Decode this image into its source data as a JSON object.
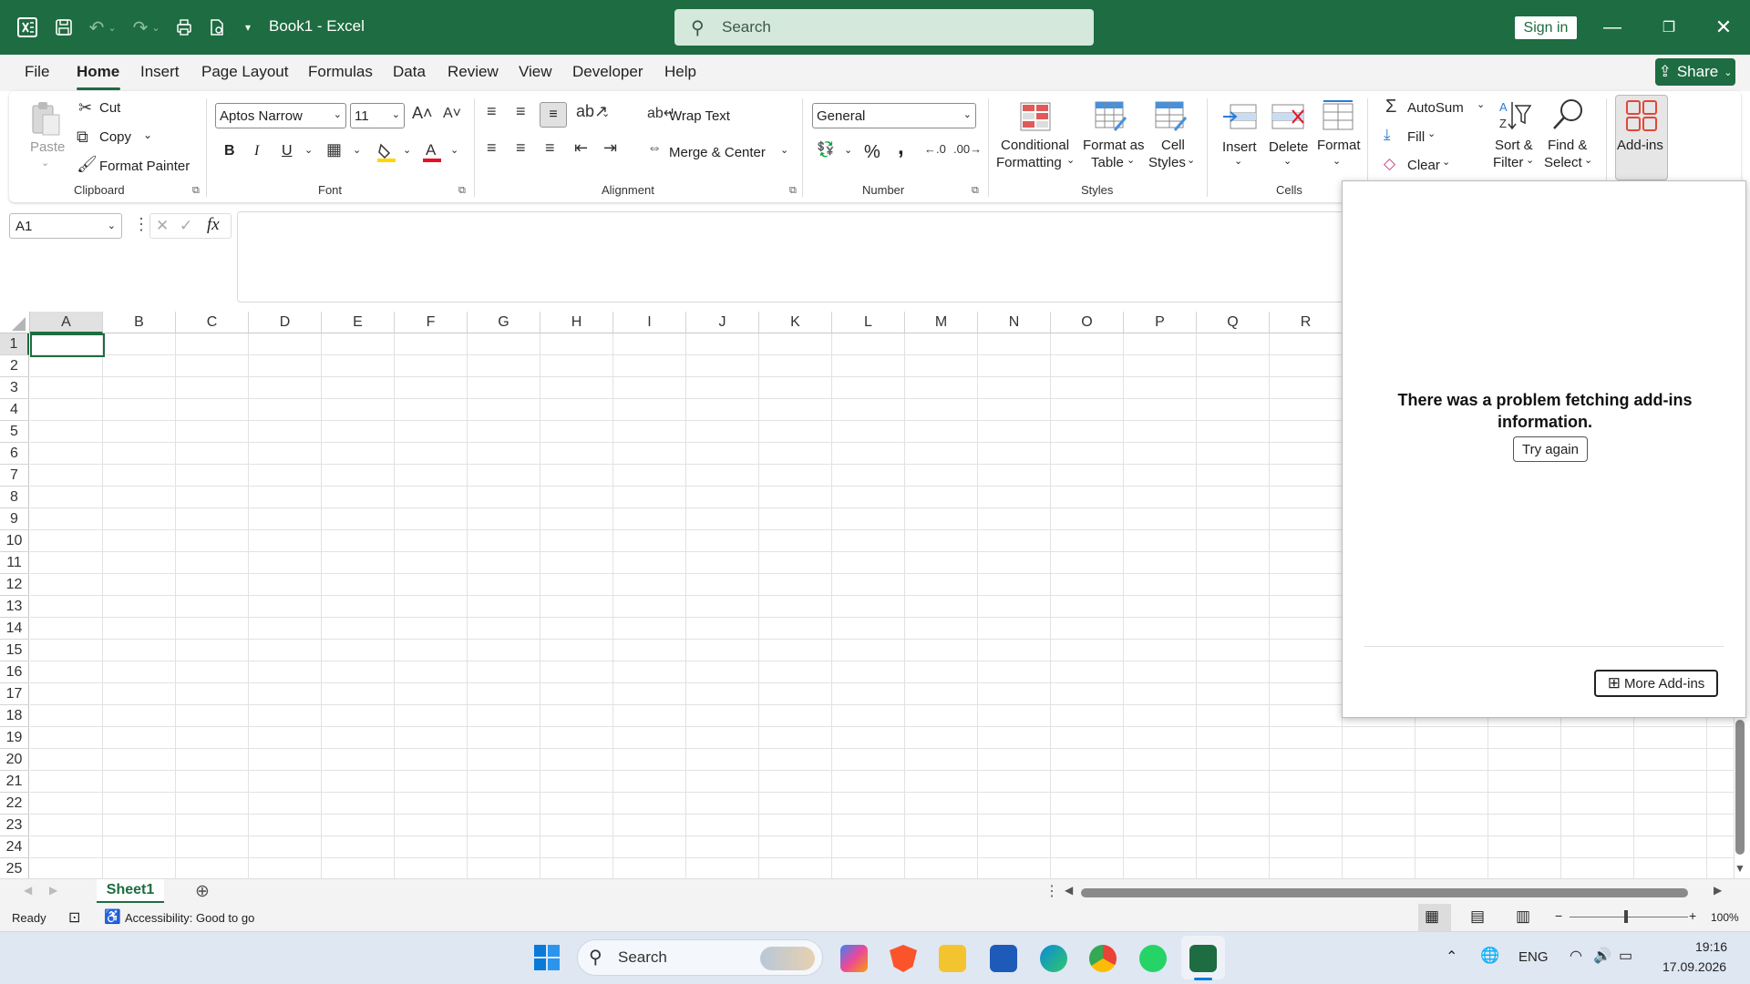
{
  "titlebar": {
    "doc_title": "Book1  -  Excel",
    "search_placeholder": "Search",
    "sign_in": "Sign in",
    "accent": "#1e6c41"
  },
  "menu": {
    "items": [
      "File",
      "Home",
      "Insert",
      "Page Layout",
      "Formulas",
      "Data",
      "Review",
      "View",
      "Developer",
      "Help"
    ],
    "active": "Home",
    "share_label": "Share"
  },
  "ribbon": {
    "clipboard": {
      "paste": "Paste",
      "cut": "Cut",
      "copy": "Copy",
      "format_painter": "Format Painter",
      "group": "Clipboard"
    },
    "font": {
      "font_name": "Aptos Narrow",
      "font_size": "11",
      "bold": "B",
      "italic": "I",
      "underline": "U",
      "group": "Font"
    },
    "alignment": {
      "wrap_text": "Wrap Text",
      "merge_center": "Merge & Center",
      "group": "Alignment"
    },
    "number": {
      "format": "General",
      "percent": "%",
      "comma": ",",
      "group": "Number"
    },
    "styles": {
      "conditional_1": "Conditional",
      "conditional_2": "Formatting",
      "format_table_1": "Format as",
      "format_table_2": "Table",
      "cell_styles_1": "Cell",
      "cell_styles_2": "Styles",
      "group": "Styles"
    },
    "cells": {
      "insert": "Insert",
      "delete": "Delete",
      "format": "Format",
      "group": "Cells"
    },
    "editing": {
      "autosum": "AutoSum",
      "fill": "Fill",
      "clear": "Clear",
      "sort_1": "Sort &",
      "sort_2": "Filter",
      "find_1": "Find &",
      "find_2": "Select"
    },
    "addins": {
      "label": "Add-ins"
    }
  },
  "formula_bar": {
    "name_box": "A1",
    "fx": "fx",
    "value": ""
  },
  "grid": {
    "columns": [
      "A",
      "B",
      "C",
      "D",
      "E",
      "F",
      "G",
      "H",
      "I",
      "J",
      "K",
      "L",
      "M",
      "N",
      "O",
      "P",
      "Q",
      "R"
    ],
    "rows": [
      "1",
      "2",
      "3",
      "4",
      "5",
      "6",
      "7",
      "8",
      "9",
      "10",
      "11",
      "12",
      "13",
      "14",
      "15",
      "16",
      "17",
      "18",
      "19",
      "20",
      "21",
      "22",
      "23",
      "24",
      "25"
    ],
    "active_cell": "A1"
  },
  "addins_pane": {
    "message": "There was a problem fetching add-ins information.",
    "try_again": "Try again",
    "more_addins": "More Add-ins"
  },
  "sheets": {
    "tabs": [
      "Sheet1"
    ],
    "active": "Sheet1"
  },
  "status": {
    "ready": "Ready",
    "accessibility": "Accessibility: Good to go",
    "zoom": "100%"
  },
  "taskbar": {
    "search": "Search",
    "lang": "ENG",
    "time": "19:16",
    "date": "17.09.2026"
  }
}
